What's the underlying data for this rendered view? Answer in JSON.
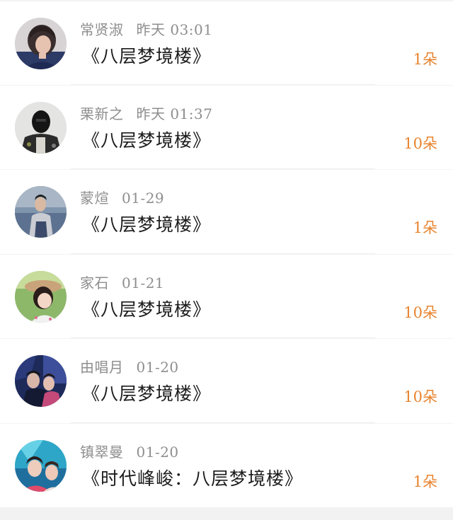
{
  "gift_color": "#e8842f",
  "items": [
    {
      "name": "常贤淑",
      "time": "昨天 03:01",
      "title": "《八层梦境楼》",
      "gift": "1朵",
      "avatar_icon": "avatar-girl-short-hair"
    },
    {
      "name": "栗新之",
      "time": "昨天 01:37",
      "title": "《八层梦境楼》",
      "gift": "10朵",
      "avatar_icon": "avatar-masked-man"
    },
    {
      "name": "蒙煊",
      "time": "01-29",
      "title": "《八层梦境楼》",
      "gift": "1朵",
      "avatar_icon": "avatar-man-seaside"
    },
    {
      "name": "家石",
      "time": "01-21",
      "title": "《八层梦境楼》",
      "gift": "10朵",
      "avatar_icon": "avatar-child-hat"
    },
    {
      "name": "由唱月",
      "time": "01-20",
      "title": "《八层梦境楼》",
      "gift": "10朵",
      "avatar_icon": "avatar-couple-night"
    },
    {
      "name": "镇翠曼",
      "time": "01-20",
      "title": "《时代峰峻：八层梦境楼》",
      "gift": "1朵",
      "avatar_icon": "avatar-girl-colorful"
    }
  ]
}
